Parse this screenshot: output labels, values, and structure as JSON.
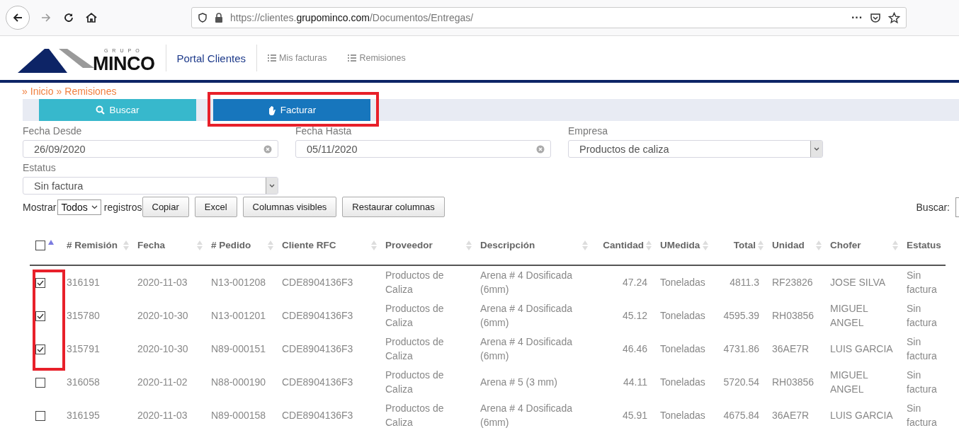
{
  "browser": {
    "url": "https://clientes.**grupominco.com**/Documentos/Entregas/",
    "menu": "···"
  },
  "header": {
    "logo_small": "GRUPO",
    "logo": "MINCO",
    "portal": "Portal Clientes",
    "nav": [
      {
        "label": "Mis facturas"
      },
      {
        "label": "Remisiones"
      }
    ]
  },
  "breadcrumb": [
    {
      "sep": "»",
      "label": "Inicio"
    },
    {
      "sep": "»",
      "label": "Remisiones"
    }
  ],
  "actions": [
    {
      "label": "Buscar",
      "kind": "search",
      "annotated": false
    },
    {
      "label": "Facturar",
      "kind": "invoice",
      "annotated": true
    }
  ],
  "filters": {
    "fecha_desde": {
      "label": "Fecha Desde",
      "value": "26/09/2020"
    },
    "fecha_hasta": {
      "label": "Fecha Hasta",
      "value": "05/11/2020"
    },
    "empresa": {
      "label": "Empresa",
      "value": "Productos de caliza"
    },
    "estatus": {
      "label": "Estatus",
      "value": "Sin factura"
    }
  },
  "length": {
    "prefix": "Mostrar",
    "value": "Todos",
    "suffix": "registros"
  },
  "export_buttons": [
    "Copiar",
    "Excel",
    "Columnas visibles",
    "Restaurar columnas"
  ],
  "search": {
    "label": "Buscar:"
  },
  "table": {
    "select_all_checked": false,
    "columns": [
      {
        "label": "# Remisión"
      },
      {
        "label": "Fecha"
      },
      {
        "label": "# Pedido"
      },
      {
        "label": "Cliente RFC"
      },
      {
        "label": "Proveedor"
      },
      {
        "label": "Descripción"
      },
      {
        "label": "Cantidad"
      },
      {
        "label": "UMedida"
      },
      {
        "label": "Total"
      },
      {
        "label": "Unidad"
      },
      {
        "label": "Chofer"
      },
      {
        "label": "Estatus"
      }
    ],
    "rows": [
      {
        "selected": true,
        "annotated": true,
        "cells": [
          "316191",
          "2020-11-03",
          "N13-001208",
          "CDE8904136F3",
          "Productos de Caliza",
          "Arena # 4 Dosificada (6mm)",
          "47.24",
          "Toneladas",
          "4811.3",
          "RF23826",
          "JOSE SILVA",
          "Sin factura"
        ]
      },
      {
        "selected": true,
        "annotated": true,
        "cells": [
          "315780",
          "2020-10-30",
          "N13-001201",
          "CDE8904136F3",
          "Productos de Caliza",
          "Arena # 4 Dosificada (6mm)",
          "45.12",
          "Toneladas",
          "4595.39",
          "RH03856",
          "MIGUEL ANGEL",
          "Sin factura"
        ]
      },
      {
        "selected": true,
        "annotated": true,
        "cells": [
          "315791",
          "2020-10-30",
          "N89-000151",
          "CDE8904136F3",
          "Productos de Caliza",
          "Arena # 4 Dosificada (6mm)",
          "46.46",
          "Toneladas",
          "4731.86",
          "36AE7R",
          "LUIS GARCIA",
          "Sin factura"
        ]
      },
      {
        "selected": false,
        "annotated": false,
        "cells": [
          "316058",
          "2020-11-02",
          "N88-000190",
          "CDE8904136F3",
          "Productos de Caliza",
          "Arena # 5 (3 mm)",
          "44.11",
          "Toneladas",
          "5720.54",
          "RH03856",
          "MIGUEL ANGEL",
          "Sin factura"
        ]
      },
      {
        "selected": false,
        "annotated": false,
        "cells": [
          "316195",
          "2020-11-03",
          "N89-000158",
          "CDE8904136F3",
          "Productos de Caliza",
          "Arena # 4 Dosificada (6mm)",
          "45.91",
          "Toneladas",
          "4675.84",
          "36AE7R",
          "LUIS GARCIA",
          "Sin factura"
        ]
      }
    ]
  }
}
